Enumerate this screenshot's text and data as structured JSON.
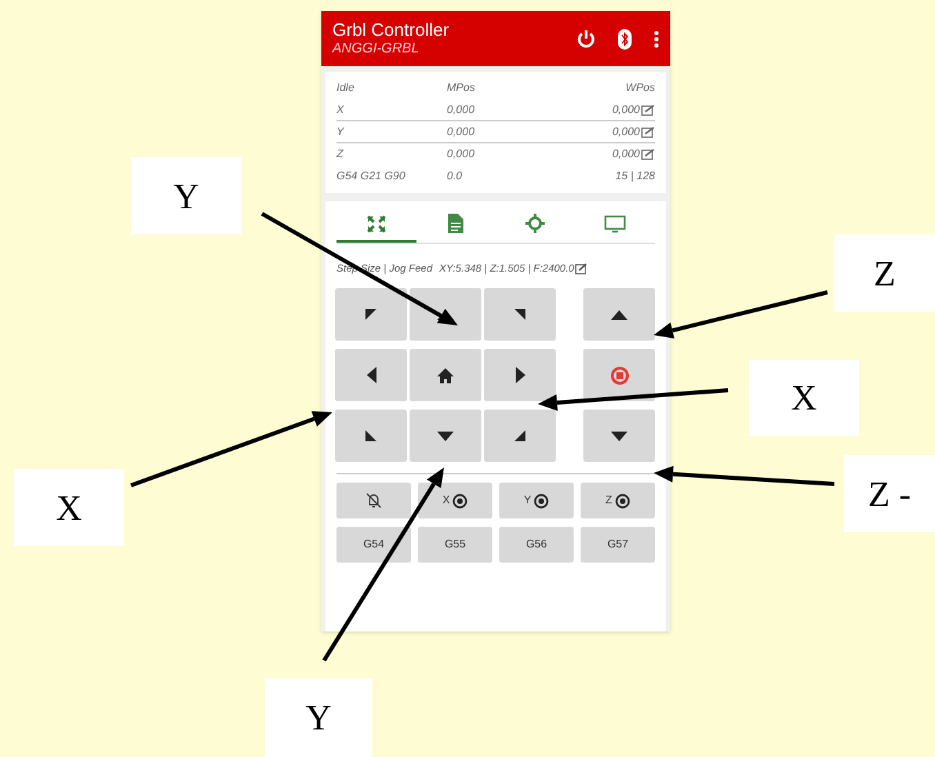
{
  "app": {
    "title": "Grbl Controller",
    "subtitle": "ANGGI-GRBL"
  },
  "status": {
    "headers": [
      "Idle",
      "MPos",
      "WPos"
    ],
    "rows": [
      {
        "axis": "X",
        "mpos": "0,000",
        "wpos": "0,000"
      },
      {
        "axis": "Y",
        "mpos": "0,000",
        "wpos": "0,000"
      },
      {
        "axis": "Z",
        "mpos": "0,000",
        "wpos": "0,000"
      }
    ],
    "footer": [
      "G54 G21 G90",
      "0.0",
      "15 | 128"
    ]
  },
  "tabs": [
    {
      "selected": true
    },
    {
      "selected": false
    },
    {
      "selected": false
    },
    {
      "selected": false
    }
  ],
  "step_line": {
    "label": "Step Size | Jog Feed",
    "values": "XY:5.348 | Z:1.505 | F:2400.0"
  },
  "zero_buttons": [
    "X",
    "Y",
    "Z"
  ],
  "wcs_buttons": [
    "G54",
    "G55",
    "G56",
    "G57"
  ],
  "callouts": [
    {
      "text": "Y"
    },
    {
      "text": "Z"
    },
    {
      "text": "X"
    },
    {
      "text": "X"
    },
    {
      "text": "Z -"
    },
    {
      "text": "Y"
    }
  ]
}
